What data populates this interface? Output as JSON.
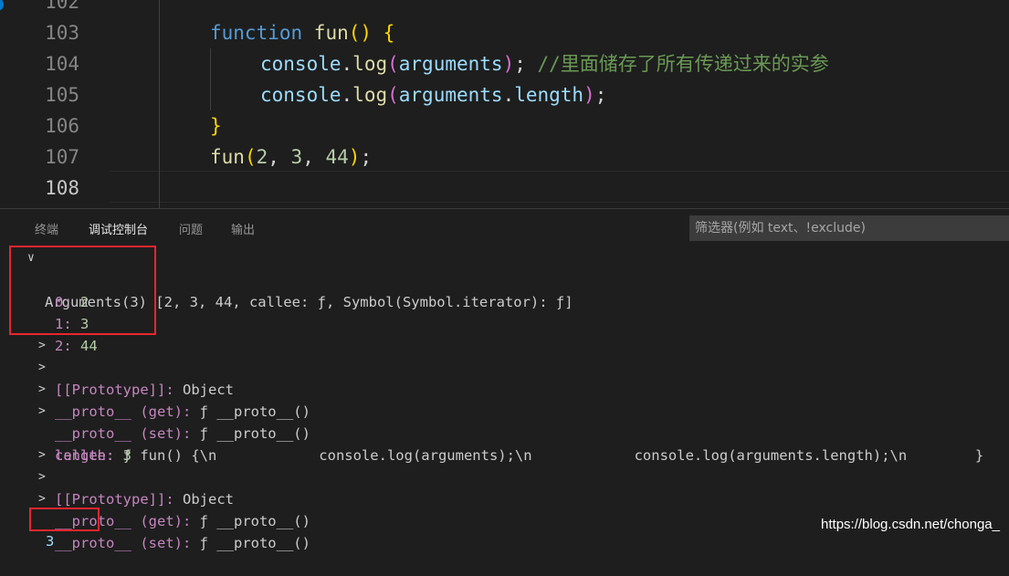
{
  "editor": {
    "lines": [
      {
        "number": "102"
      },
      {
        "number": "103",
        "tokens": [
          [
            "kw",
            "function "
          ],
          [
            "fn",
            "fun"
          ],
          [
            "br1",
            "() {"
          ]
        ]
      },
      {
        "number": "104",
        "tokens": [
          [
            "var",
            "console"
          ],
          [
            "pn",
            "."
          ],
          [
            "fn",
            "log"
          ],
          [
            "br2",
            "("
          ],
          [
            "var",
            "arguments"
          ],
          [
            "br2",
            ")"
          ],
          [
            "pn",
            "; "
          ],
          [
            "cmt",
            "//里面储存了所有传递过来的实参"
          ]
        ]
      },
      {
        "number": "105",
        "tokens": [
          [
            "var",
            "console"
          ],
          [
            "pn",
            "."
          ],
          [
            "fn",
            "log"
          ],
          [
            "br2",
            "("
          ],
          [
            "var",
            "arguments"
          ],
          [
            "pn",
            "."
          ],
          [
            "var",
            "length"
          ],
          [
            "br2",
            ")"
          ],
          [
            "pn",
            ";"
          ]
        ]
      },
      {
        "number": "106",
        "tokens": [
          [
            "br1",
            "}"
          ]
        ]
      },
      {
        "number": "107",
        "tokens": [
          [
            "fn",
            "fun"
          ],
          [
            "br1",
            "("
          ],
          [
            "num",
            "2"
          ],
          [
            "pn",
            ", "
          ],
          [
            "num",
            "3"
          ],
          [
            "pn",
            ", "
          ],
          [
            "num",
            "44"
          ],
          [
            "br1",
            ")"
          ],
          [
            "pn",
            ";"
          ]
        ]
      },
      {
        "number": "108"
      }
    ]
  },
  "panel": {
    "tabs": [
      "终端",
      "调试控制台",
      "问题",
      "输出"
    ],
    "active_tab": "调试控制台",
    "filter_placeholder": "筛选器(例如 text、!exclude)"
  },
  "console": {
    "arguments_header": "Arguments(3)",
    "arguments_preview": "[2, 3, 44, callee: ƒ, Symbol(Symbol.iterator): ƒ]",
    "entries": [
      {
        "key": "0",
        "value": "2"
      },
      {
        "key": "1",
        "value": "3"
      },
      {
        "key": "2",
        "value": "44"
      }
    ],
    "prototype_label": "[[Prototype]]",
    "prototype_value": "Object",
    "proto_get_label": "__proto__ (get)",
    "proto_set_label": "__proto__ (set)",
    "proto_fn_value": "ƒ __proto__()",
    "callee_label": "callee",
    "callee_value": "ƒ fun() {\\n            console.log(arguments);\\n            console.log(arguments.length);\\n        }",
    "length_label": "length",
    "length_value": "3",
    "proto2_label": "[[Prototype]]",
    "proto2_value": "Object",
    "proto2_get_label": "__proto__ (get)",
    "proto2_set_label": "__proto__ (set)",
    "proto2_fn_value": "ƒ __proto__()",
    "output_value": "3"
  },
  "watermark": "https://blog.csdn.net/chonga_",
  "colors": {
    "highlight_box": "#e8262d",
    "accent": "#007acc"
  }
}
